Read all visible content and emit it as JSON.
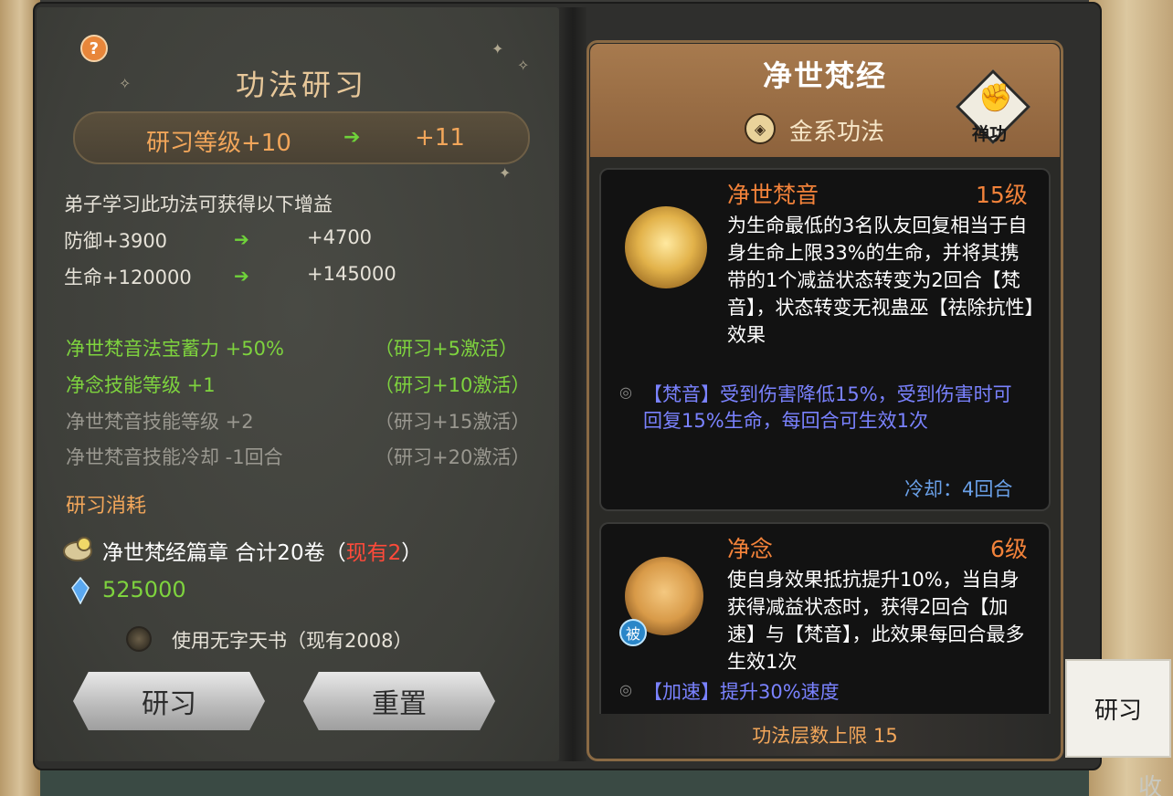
{
  "left_page": {
    "help_icon": "?",
    "title": "功法研习",
    "level_from": "研习等级+10",
    "level_arrow": "➔",
    "level_to": "+11",
    "benefit_desc": "弟子学习此功法可获得以下增益",
    "stats": [
      {
        "from": "防御+3900",
        "arrow": "➔",
        "to": "+4700"
      },
      {
        "from": "生命+120000",
        "arrow": "➔",
        "to": "+145000"
      }
    ],
    "bonuses": [
      {
        "name": "净世梵音法宝蓄力 +50%",
        "req": "（研习+5激活）",
        "active": true
      },
      {
        "name": "净念技能等级 +1",
        "req": "（研习+10激活）",
        "active": true
      },
      {
        "name": "净世梵音技能等级 +2",
        "req": "（研习+15激活）",
        "active": false
      },
      {
        "name": "净世梵音技能冷却 -1回合",
        "req": "（研习+20激活）",
        "active": false
      }
    ],
    "cost_title": "研习消耗",
    "cost_book": "净世梵经篇章  合计20卷（",
    "cost_have": "现有2",
    "cost_close": "）",
    "cost_silver": "525000",
    "use_book": "使用无字天书（现有2008）",
    "btn_study": "研习",
    "btn_reset": "重置"
  },
  "right_page": {
    "title": "净世梵经",
    "element": "金系功法",
    "badge": "禅功",
    "skills": [
      {
        "name": "净世梵音",
        "level": "15级",
        "desc": "为生命最低的3名队友回复相当于自身生命上限33%的生命，并将其携带的1个减益状态转变为2回合【梵音】，状态转变无视蛊巫【祛除抗性】效果",
        "effect": "【梵音】受到伤害降低15%，受到伤害时可回复15%生命，每回合可生效1次",
        "cooldown": "冷却：4回合"
      },
      {
        "name": "净念",
        "level": "6级",
        "desc": "使自身效果抵抗提升10%，当自身获得减益状态时，获得2回合【加速】与【梵音】，此效果每回合最多生效1次",
        "effect": "【加速】提升30%速度",
        "tag": "被"
      }
    ],
    "footer": "功法层数上限 15"
  },
  "side_tab": "研习",
  "corner_char": "收",
  "colors": {
    "accent_orange": "#f2a65a",
    "active_green": "#7ed33e",
    "inactive_gray": "#9a9890",
    "effect_blue": "#7a82ff",
    "warning_red": "#ff4a3a"
  }
}
